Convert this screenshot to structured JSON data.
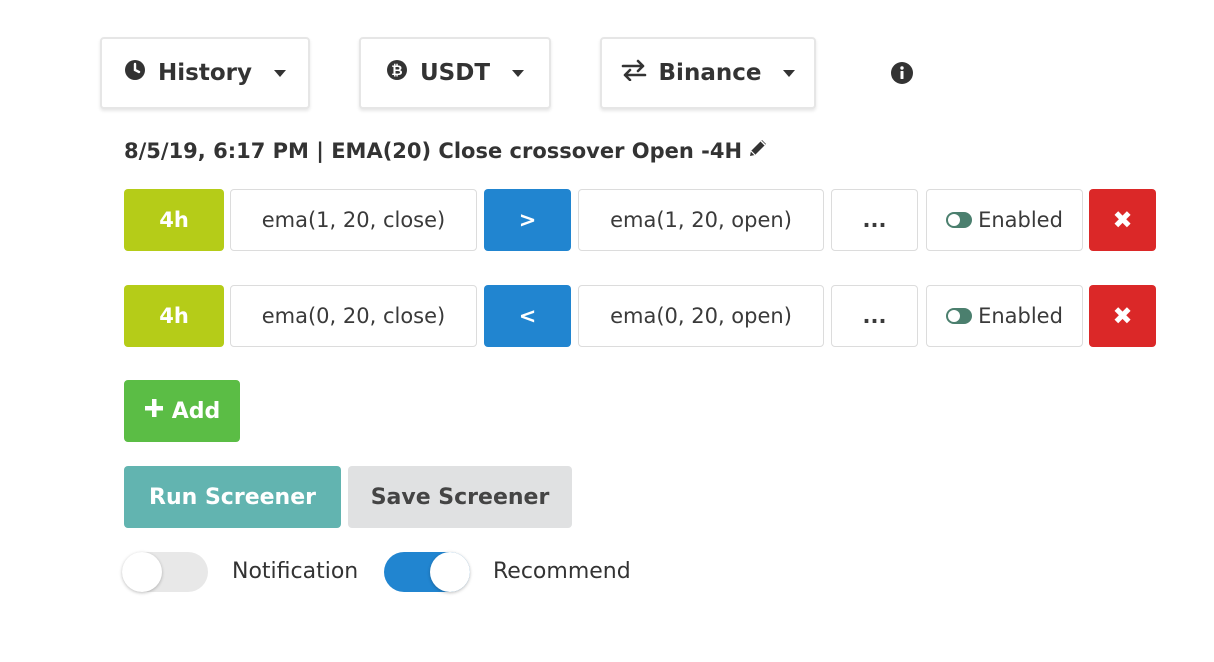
{
  "toolbar": {
    "history_label": "History",
    "currency_label": "USDT",
    "exchange_label": "Binance"
  },
  "screener_title": "8/5/19, 6:17 PM | EMA(20) Close crossover Open -4H",
  "conditions": [
    {
      "timeframe": "4h",
      "left_expr": "ema(1, 20, close)",
      "operator": ">",
      "right_expr": "ema(1, 20, open)",
      "more": "...",
      "status": "Enabled",
      "delete": "✖"
    },
    {
      "timeframe": "4h",
      "left_expr": "ema(0, 20, close)",
      "operator": "<",
      "right_expr": "ema(0, 20, open)",
      "more": "...",
      "status": "Enabled",
      "delete": "✖"
    }
  ],
  "actions": {
    "add_label": "Add",
    "run_label": "Run Screener",
    "save_label": "Save Screener"
  },
  "toggles": {
    "notification_label": "Notification",
    "notification_on": false,
    "recommend_label": "Recommend",
    "recommend_on": true
  },
  "colors": {
    "timeframe": "#b5cc18",
    "operator": "#2185d0",
    "delete": "#db2828",
    "add": "#5bbd45",
    "run": "#62b4b0",
    "toggle_on": "#2185d0"
  },
  "icons": {
    "history": "clock-icon",
    "currency": "bitcoin-icon",
    "exchange": "exchange-arrows-icon",
    "info": "info-circle-icon",
    "edit": "pencil-icon",
    "add": "plus-icon",
    "delete": "close-x-icon"
  }
}
